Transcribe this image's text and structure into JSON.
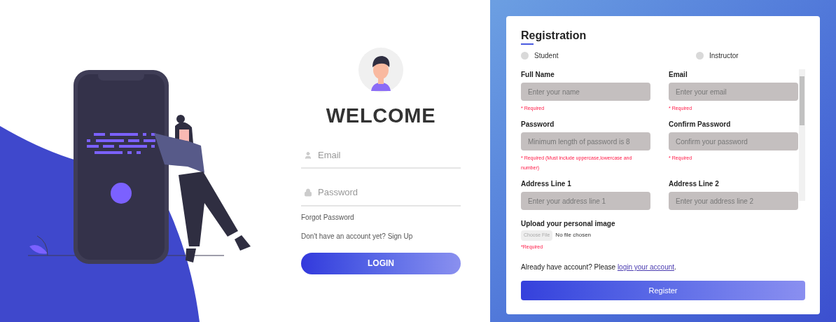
{
  "login": {
    "title": "WELCOME",
    "fields": [
      {
        "kind": "email",
        "placeholder": "Email"
      },
      {
        "kind": "password",
        "placeholder": "Password"
      }
    ],
    "forgot_link": "Forgot Password",
    "signup_prompt": "Don't have an account yet? Sign Up",
    "login_button": "LOGIN"
  },
  "registration": {
    "title": "Registration",
    "roles": [
      {
        "label": "Student",
        "selected": false
      },
      {
        "label": "Instructor",
        "selected": false
      }
    ],
    "fields": [
      {
        "label": "Full Name",
        "placeholder": "Enter your name",
        "hint": "* Required"
      },
      {
        "label": "Email",
        "placeholder": "Enter your email",
        "hint": "* Required"
      },
      {
        "label": "Password",
        "placeholder": "Minimum length of password is 8",
        "hint": "* Required (Must include uppercase,lowercase and number)"
      },
      {
        "label": "Confirm Password",
        "placeholder": "Confirm your password",
        "hint": "* Required"
      },
      {
        "label": "Address Line 1",
        "placeholder": "Enter your address line 1"
      },
      {
        "label": "Address Line 2",
        "placeholder": "Enter your address line 2"
      }
    ],
    "upload": {
      "label": "Upload your personal image",
      "button": "Choose File",
      "status": "No file chosen",
      "hint": "*Required"
    },
    "login_prompt": "Already have account? Please",
    "login_link": "login your account",
    "login_suffix": ".",
    "register_button": "Register"
  }
}
